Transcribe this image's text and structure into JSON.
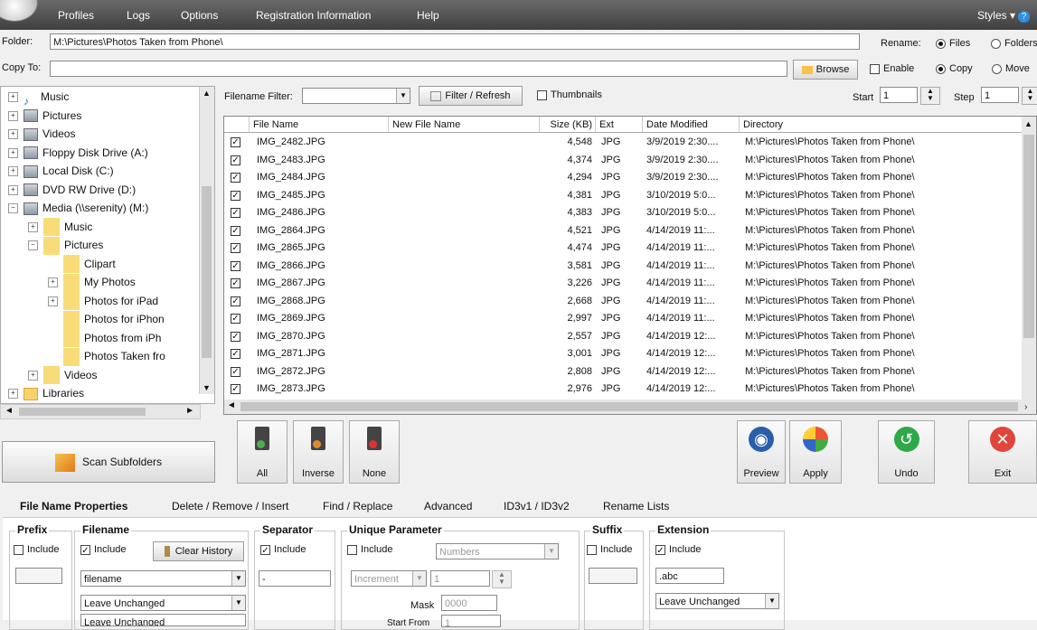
{
  "menu": [
    "Profiles",
    "Logs",
    "Options",
    "Registration Information",
    "Help"
  ],
  "styles_label": "Styles",
  "folder": {
    "label": "Folder:",
    "value": "M:\\Pictures\\Photos Taken from Phone\\"
  },
  "copy_to": {
    "label": "Copy To:",
    "value": ""
  },
  "rename": {
    "label": "Rename:",
    "files": "Files",
    "folders": "Folders"
  },
  "browse_label": "Browse",
  "enable_label": "Enable",
  "copy_label": "Copy",
  "move_label": "Move",
  "filter": {
    "label": "Filename Filter:",
    "value": "",
    "button": "Filter / Refresh",
    "thumbnails": "Thumbnails"
  },
  "start": {
    "label": "Start",
    "value": "1"
  },
  "step": {
    "label": "Step",
    "value": "1"
  },
  "tree": [
    {
      "label": "Music",
      "indent": 0,
      "icon": "music-icon"
    },
    {
      "label": "Pictures",
      "indent": 0,
      "icon": "pictures-icon"
    },
    {
      "label": "Videos",
      "indent": 0,
      "icon": "videos-icon"
    },
    {
      "label": "Floppy Disk Drive (A:)",
      "indent": 0,
      "icon": "floppy-icon"
    },
    {
      "label": "Local Disk (C:)",
      "indent": 0,
      "icon": "disk-icon"
    },
    {
      "label": "DVD RW Drive (D:)",
      "indent": 0,
      "icon": "dvd-icon"
    },
    {
      "label": "Media (\\\\serenity) (M:)",
      "indent": 0,
      "icon": "network-drive-icon"
    },
    {
      "label": "Music",
      "indent": 1,
      "icon": "folder-icon"
    },
    {
      "label": "Pictures",
      "indent": 1,
      "icon": "folder-icon"
    },
    {
      "label": "Clipart",
      "indent": 2,
      "icon": "folder-icon"
    },
    {
      "label": "My Photos",
      "indent": 2,
      "icon": "folder-icon"
    },
    {
      "label": "Photos for iPad",
      "indent": 2,
      "icon": "folder-icon"
    },
    {
      "label": "Photos for iPhon",
      "indent": 2,
      "icon": "folder-icon"
    },
    {
      "label": "Photos from iPh",
      "indent": 2,
      "icon": "folder-icon"
    },
    {
      "label": "Photos Taken fro",
      "indent": 2,
      "icon": "folder-icon"
    },
    {
      "label": "Videos",
      "indent": 1,
      "icon": "folder-icon"
    },
    {
      "label": "Libraries",
      "indent": 0,
      "icon": "libraries-icon"
    }
  ],
  "columns": [
    "File Name",
    "New File Name",
    "Size (KB)",
    "Ext",
    "Date Modified",
    "Directory"
  ],
  "rows": [
    {
      "name": "IMG_2482.JPG",
      "new": "",
      "size": "4,548",
      "ext": "JPG",
      "date": "3/9/2019 2:30....",
      "dir": "M:\\Pictures\\Photos Taken from Phone\\"
    },
    {
      "name": "IMG_2483.JPG",
      "new": "",
      "size": "4,374",
      "ext": "JPG",
      "date": "3/9/2019 2:30....",
      "dir": "M:\\Pictures\\Photos Taken from Phone\\"
    },
    {
      "name": "IMG_2484.JPG",
      "new": "",
      "size": "4,294",
      "ext": "JPG",
      "date": "3/9/2019 2:30....",
      "dir": "M:\\Pictures\\Photos Taken from Phone\\"
    },
    {
      "name": "IMG_2485.JPG",
      "new": "",
      "size": "4,381",
      "ext": "JPG",
      "date": "3/10/2019 5:0...",
      "dir": "M:\\Pictures\\Photos Taken from Phone\\"
    },
    {
      "name": "IMG_2486.JPG",
      "new": "",
      "size": "4,383",
      "ext": "JPG",
      "date": "3/10/2019 5:0...",
      "dir": "M:\\Pictures\\Photos Taken from Phone\\"
    },
    {
      "name": "IMG_2864.JPG",
      "new": "",
      "size": "4,521",
      "ext": "JPG",
      "date": "4/14/2019 11:...",
      "dir": "M:\\Pictures\\Photos Taken from Phone\\"
    },
    {
      "name": "IMG_2865.JPG",
      "new": "",
      "size": "4,474",
      "ext": "JPG",
      "date": "4/14/2019 11:...",
      "dir": "M:\\Pictures\\Photos Taken from Phone\\"
    },
    {
      "name": "IMG_2866.JPG",
      "new": "",
      "size": "3,581",
      "ext": "JPG",
      "date": "4/14/2019 11:...",
      "dir": "M:\\Pictures\\Photos Taken from Phone\\"
    },
    {
      "name": "IMG_2867.JPG",
      "new": "",
      "size": "3,226",
      "ext": "JPG",
      "date": "4/14/2019 11:...",
      "dir": "M:\\Pictures\\Photos Taken from Phone\\"
    },
    {
      "name": "IMG_2868.JPG",
      "new": "",
      "size": "2,668",
      "ext": "JPG",
      "date": "4/14/2019 11:...",
      "dir": "M:\\Pictures\\Photos Taken from Phone\\"
    },
    {
      "name": "IMG_2869.JPG",
      "new": "",
      "size": "2,997",
      "ext": "JPG",
      "date": "4/14/2019 11:...",
      "dir": "M:\\Pictures\\Photos Taken from Phone\\"
    },
    {
      "name": "IMG_2870.JPG",
      "new": "",
      "size": "2,557",
      "ext": "JPG",
      "date": "4/14/2019 12:...",
      "dir": "M:\\Pictures\\Photos Taken from Phone\\"
    },
    {
      "name": "IMG_2871.JPG",
      "new": "",
      "size": "3,001",
      "ext": "JPG",
      "date": "4/14/2019 12:...",
      "dir": "M:\\Pictures\\Photos Taken from Phone\\"
    },
    {
      "name": "IMG_2872.JPG",
      "new": "",
      "size": "2,808",
      "ext": "JPG",
      "date": "4/14/2019 12:...",
      "dir": "M:\\Pictures\\Photos Taken from Phone\\"
    },
    {
      "name": "IMG_2873.JPG",
      "new": "",
      "size": "2,976",
      "ext": "JPG",
      "date": "4/14/2019 12:...",
      "dir": "M:\\Pictures\\Photos Taken from Phone\\"
    }
  ],
  "scan_subfolders": "Scan Subfolders",
  "select_buttons": [
    "All",
    "Inverse",
    "None"
  ],
  "action_buttons": [
    "Preview",
    "Apply",
    "Undo",
    "Exit"
  ],
  "tabs": [
    "File Name Properties",
    "Delete / Remove / Insert",
    "Find / Replace",
    "Advanced",
    "ID3v1 / ID3v2",
    "Rename Lists"
  ],
  "props": {
    "prefix": {
      "title": "Prefix",
      "include": "Include"
    },
    "filename": {
      "title": "Filename",
      "include": "Include",
      "clear_history": "Clear History",
      "value": "filename",
      "case": "Leave Unchanged",
      "case2": "Leave Unchanged"
    },
    "separator": {
      "title": "Separator",
      "include": "Include",
      "value": "-"
    },
    "unique": {
      "title": "Unique Parameter",
      "include": "Include",
      "type": "Numbers",
      "increment": "Increment",
      "inc_value": "1",
      "mask_label": "Mask",
      "mask_value": "0000",
      "start_from": "Start From",
      "start_value": "1"
    },
    "suffix": {
      "title": "Suffix",
      "include": "Include"
    },
    "extension": {
      "title": "Extension",
      "include": "Include",
      "value": ".abc",
      "case": "Leave Unchanged"
    }
  },
  "colors": {
    "menubar": "#4a4a4a",
    "window": "#f0f0f0",
    "accent": "#2d8fe0"
  }
}
